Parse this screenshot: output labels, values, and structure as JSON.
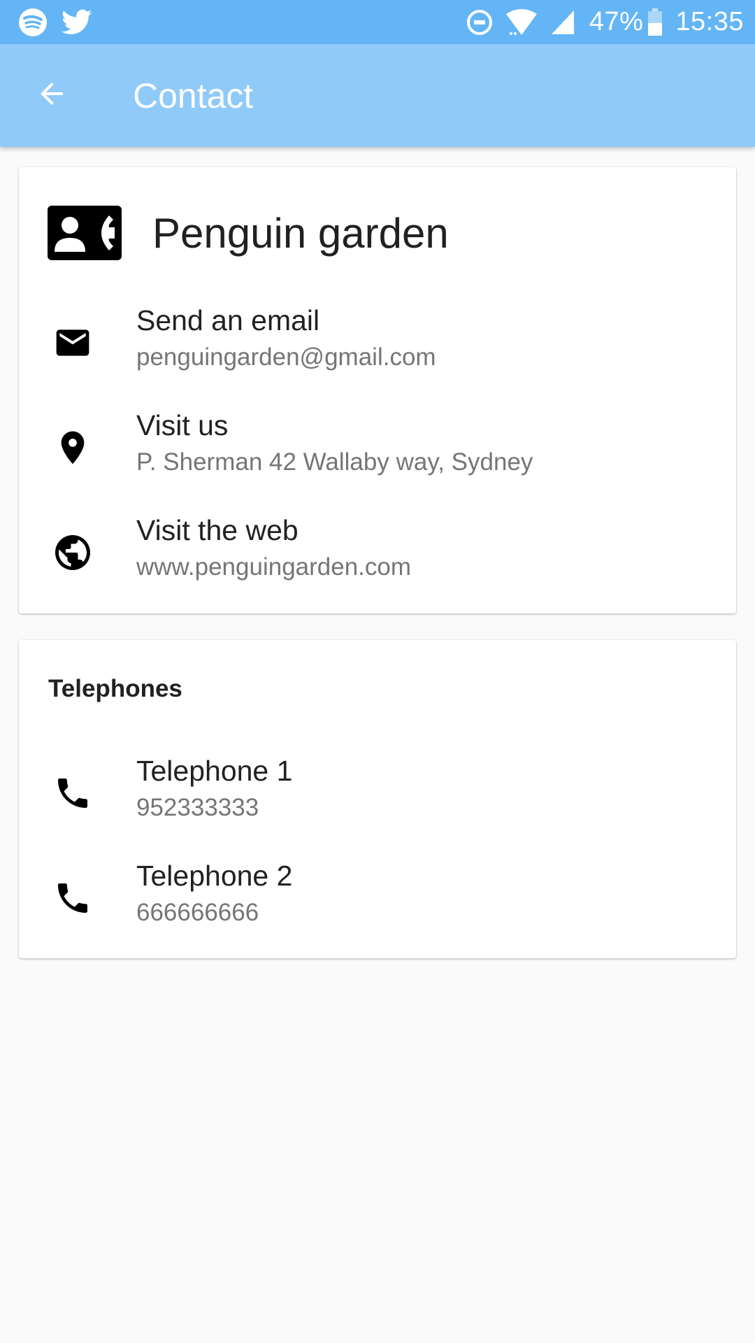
{
  "status_bar": {
    "battery_percent": "47%",
    "time": "15:35",
    "icons_left": [
      "spotify-icon",
      "twitter-icon"
    ],
    "icons_right": [
      "dnd-icon",
      "wifi-icon",
      "signal-icon",
      "battery-icon"
    ]
  },
  "app_bar": {
    "title": "Contact",
    "back_icon": "arrow-back-icon",
    "background": "#90caf9",
    "status_background": "#64b5f6"
  },
  "contact_card": {
    "name": "Penguin garden",
    "icon": "contact-phone-icon",
    "items": [
      {
        "icon": "email-icon",
        "title": "Send an email",
        "subtitle": "penguingarden@gmail.com"
      },
      {
        "icon": "location-pin-icon",
        "title": "Visit us",
        "subtitle": "P. Sherman 42 Wallaby way, Sydney"
      },
      {
        "icon": "globe-icon",
        "title": "Visit the web",
        "subtitle": "www.penguingarden.com"
      }
    ]
  },
  "telephones_card": {
    "title": "Telephones",
    "items": [
      {
        "icon": "phone-icon",
        "title": "Telephone 1",
        "subtitle": "952333333"
      },
      {
        "icon": "phone-icon",
        "title": "Telephone 2",
        "subtitle": "666666666"
      }
    ]
  }
}
